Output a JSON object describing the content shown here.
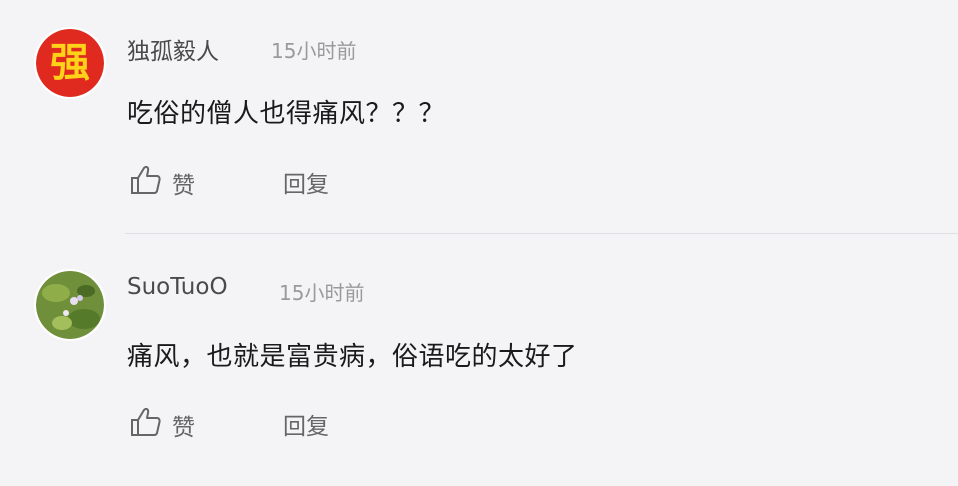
{
  "comments": [
    {
      "username": "独孤毅人",
      "time": "15小时前",
      "text": "吃俗的僧人也得痛风？？？",
      "like_label": "赞",
      "reply_label": "回复",
      "avatar_char": "强"
    },
    {
      "username": "SuoTuoO",
      "time": "15小时前",
      "text": "痛风，也就是富贵病，俗语吃的太好了",
      "like_label": "赞",
      "reply_label": "回复"
    }
  ],
  "colors": {
    "background": "#f4f3f6",
    "username": "#4a4a4a",
    "timestamp": "#9a9a9a",
    "text": "#1a1a1a",
    "action": "#666666"
  },
  "icons": [
    "thumbs-up-icon"
  ]
}
